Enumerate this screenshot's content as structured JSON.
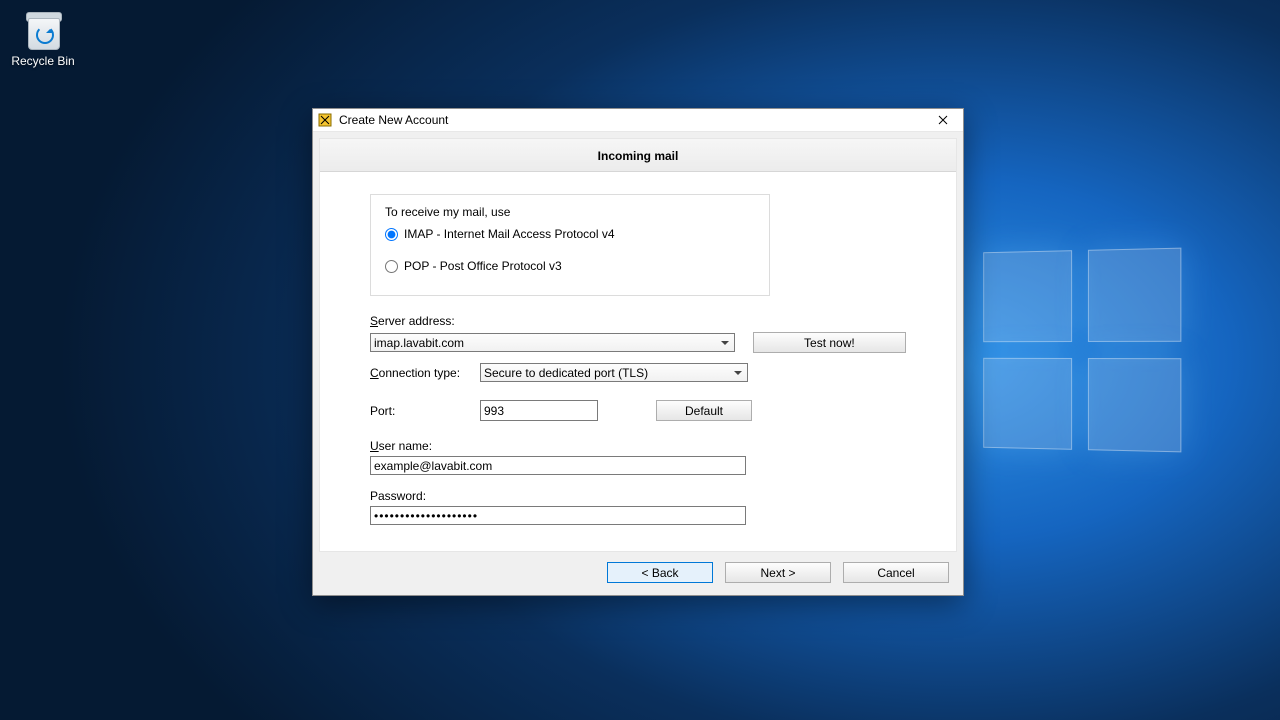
{
  "desktop": {
    "recycle_bin_label": "Recycle Bin"
  },
  "window": {
    "title": "Create New Account"
  },
  "wizard": {
    "header": "Incoming mail",
    "protocol_legend": "To receive my mail, use",
    "protocol_options": {
      "imap": "IMAP - Internet Mail Access Protocol v4",
      "pop": "POP  -  Post Office Protocol v3"
    },
    "protocol_selected": "imap",
    "server_label": "Server address:",
    "server_value": "imap.lavabit.com",
    "test_button": "Test now!",
    "connection_label": "Connection type:",
    "connection_value": "Secure to dedicated port (TLS)",
    "port_label": "Port:",
    "port_value": "993",
    "default_button": "Default",
    "username_label": "User name:",
    "username_value": "example@lavabit.com",
    "password_label": "Password:",
    "password_value": "••••••••••••••••••••"
  },
  "footer": {
    "back": "<  Back",
    "next": "Next  >",
    "cancel": "Cancel"
  }
}
